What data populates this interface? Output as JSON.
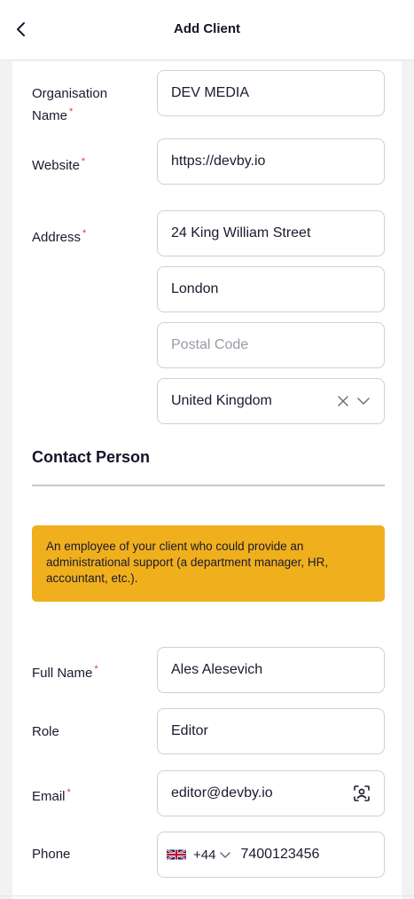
{
  "header": {
    "title": "Add Client"
  },
  "form": {
    "organisation_name": {
      "label": "Organisation Name",
      "value": "DEV MEDIA"
    },
    "website": {
      "label": "Website",
      "value": "https://devby.io"
    },
    "address": {
      "label": "Address",
      "street": "24 King William Street",
      "city": "London",
      "postal_placeholder": "Postal Code",
      "country": "United Kingdom"
    },
    "required_mark": "*"
  },
  "contact": {
    "section_title": "Contact Person",
    "notice": "An employee of your client who could provide an administrational support (a department manager, HR, accountant, etc.).",
    "full_name": {
      "label": "Full Name",
      "value": "Ales Alesevich"
    },
    "role": {
      "label": "Role",
      "value": "Editor"
    },
    "email": {
      "label": "Email",
      "value": "editor@devby.io"
    },
    "phone": {
      "label": "Phone",
      "country_code": "+44",
      "number": "7400123456"
    }
  },
  "colors": {
    "accent": "#f0b01d",
    "required": "#e0344b",
    "border": "#cfcfd6"
  }
}
